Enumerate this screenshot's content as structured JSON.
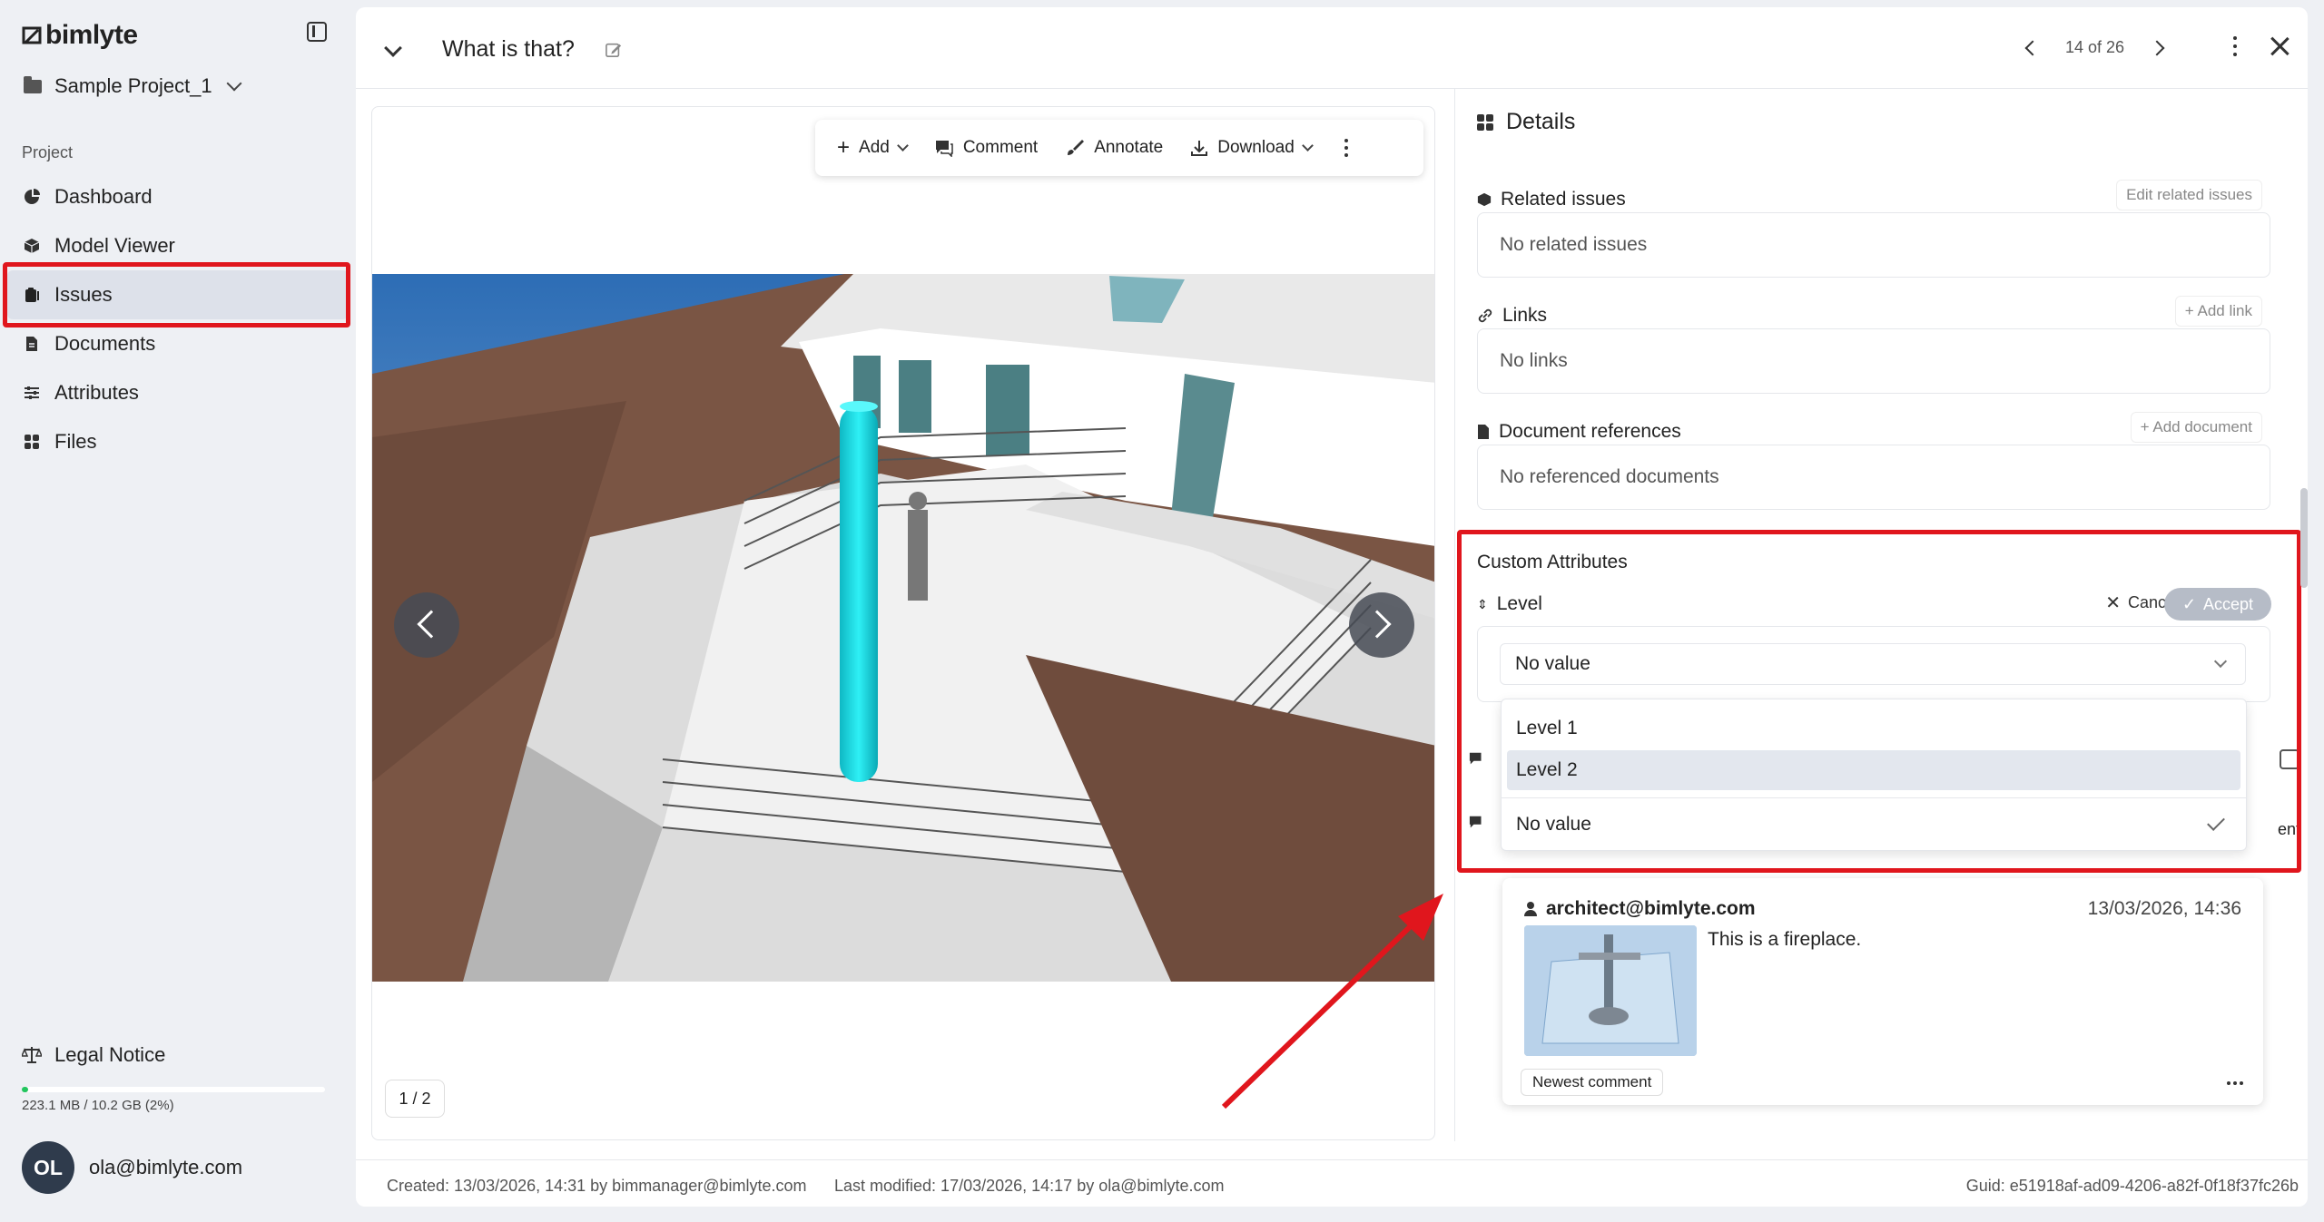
{
  "app": {
    "name": "bimlyte"
  },
  "sidebar": {
    "project_name": "Sample Project_1",
    "section_label": "Project",
    "items": [
      {
        "label": "Dashboard",
        "icon": "pie-chart-icon"
      },
      {
        "label": "Model Viewer",
        "icon": "cube-icon"
      },
      {
        "label": "Issues",
        "icon": "clipboard-icon"
      },
      {
        "label": "Documents",
        "icon": "document-icon"
      },
      {
        "label": "Attributes",
        "icon": "sliders-icon"
      },
      {
        "label": "Files",
        "icon": "grid-icon"
      }
    ],
    "active_item": "Issues",
    "legal_notice": "Legal Notice",
    "storage_text": "223.1 MB / 10.2 GB (2%)",
    "storage_fraction": 0.02,
    "user_initials": "OL",
    "user_email": "ola@bimlyte.com"
  },
  "header": {
    "title": "What is that?",
    "pager": "14 of 26"
  },
  "viewer_toolbar": {
    "add": "Add",
    "comment": "Comment",
    "annotate": "Annotate",
    "download": "Download"
  },
  "viewer": {
    "page_indicator": "1 / 2"
  },
  "details": {
    "title": "Details",
    "related_issues": {
      "title": "Related issues",
      "action": "Edit related issues",
      "empty": "No related issues"
    },
    "links": {
      "title": "Links",
      "action": "Add link",
      "empty": "No links"
    },
    "document_refs": {
      "title": "Document references",
      "action": "Add document",
      "empty": "No referenced documents"
    },
    "custom_attributes": {
      "title": "Custom Attributes",
      "field_label": "Level",
      "cancel": "Cancel",
      "accept": "Accept",
      "selected_value": "No value",
      "options": [
        "Level 1",
        "Level 2",
        "No value"
      ],
      "hovered_option": "Level 2",
      "checked_option": "No value"
    },
    "partial_text": "ent",
    "comment": {
      "author": "architect@bimlyte.com",
      "date": "13/03/2026, 14:36",
      "text": "This is a fireplace.",
      "badge": "Newest comment"
    }
  },
  "footer": {
    "created": "Created: 13/03/2026, 14:31 by bimmanager@bimlyte.com",
    "modified": "Last modified: 17/03/2026, 14:17 by ola@bimlyte.com",
    "guid": "Guid: e51918af-ad09-4206-a82f-0f18f37fc26b"
  },
  "colors": {
    "annotation_red": "#e0161d",
    "accent_cyan": "#1ad9e0",
    "storage_green": "#22c55e"
  }
}
